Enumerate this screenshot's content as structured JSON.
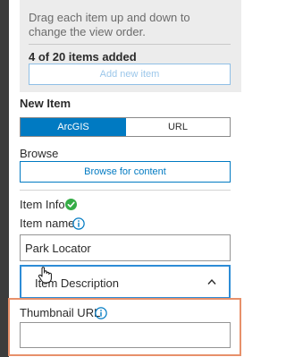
{
  "instructions": "Drag each item up and down to change the view order.",
  "items_count": "4 of 20 items added",
  "add_new_item_label": "Add new item",
  "new_item": {
    "title": "New Item",
    "segments": [
      "ArcGIS",
      "URL"
    ],
    "selected_segment": "ArcGIS"
  },
  "browse": {
    "label": "Browse",
    "button_label": "Browse for content"
  },
  "item_info": {
    "label": "Item Info",
    "status": "complete",
    "item_name_label": "Item name",
    "item_name_value": "Park Locator"
  },
  "accordion": {
    "title": "Item Description",
    "expanded": true
  },
  "thumbnail": {
    "label": "Thumbnail URL",
    "value": ""
  },
  "colors": {
    "accent": "#007ac2",
    "success": "#35ac46",
    "highlight": "#e7906a",
    "focus": "#2d8cd6"
  },
  "icons": [
    "check-circle-icon",
    "info-icon",
    "chevron-up-icon",
    "hand-cursor-icon"
  ]
}
